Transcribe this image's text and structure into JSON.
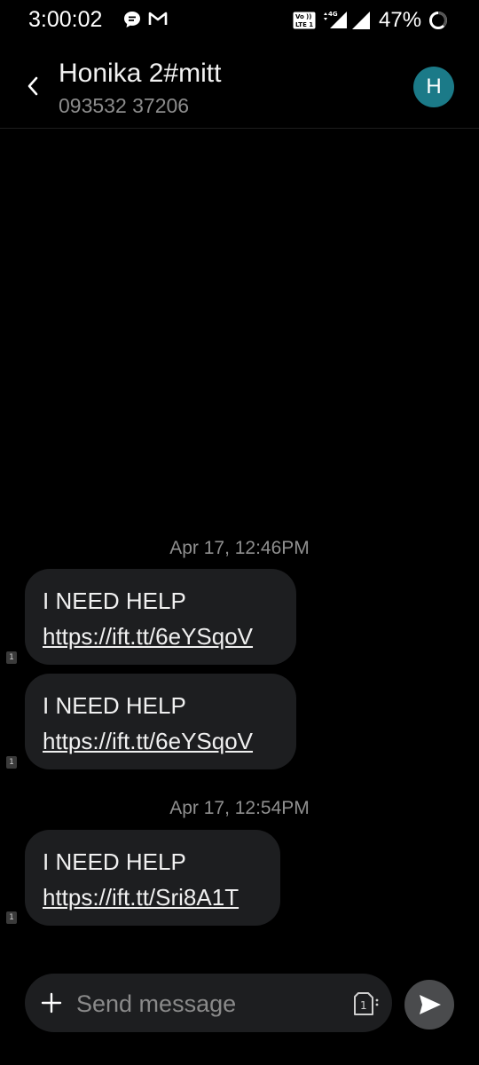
{
  "status_bar": {
    "time": "3:00:02",
    "battery_percent": "47%",
    "icons": [
      "chat-bubble-icon",
      "gmail-icon",
      "volte-icon",
      "4g-signal-icon",
      "signal-icon",
      "battery-ring-icon"
    ]
  },
  "header": {
    "contact_name": "Honika 2#mitt",
    "contact_number": "093532 37206",
    "avatar_letter": "H",
    "avatar_color": "#1b7a88"
  },
  "conversation": {
    "groups": [
      {
        "timestamp": "Apr 17, 12:46PM",
        "messages": [
          {
            "text": "I NEED HELP",
            "link": "https://ift.tt/6eYSqoV",
            "sim": "1"
          },
          {
            "text": "I NEED HELP",
            "link": "https://ift.tt/6eYSqoV",
            "sim": "1"
          }
        ]
      },
      {
        "timestamp": "Apr 17, 12:54PM",
        "messages": [
          {
            "text": "I NEED HELP",
            "link": "https://ift.tt/Sri8A1T",
            "sim": "1"
          }
        ]
      }
    ]
  },
  "composer": {
    "placeholder": "Send message",
    "value": "",
    "sim_label": "1"
  },
  "colors": {
    "background": "#000000",
    "bubble": "#1d1e20",
    "send_button": "#4a4b4d",
    "muted_text": "#8f8f8f"
  }
}
